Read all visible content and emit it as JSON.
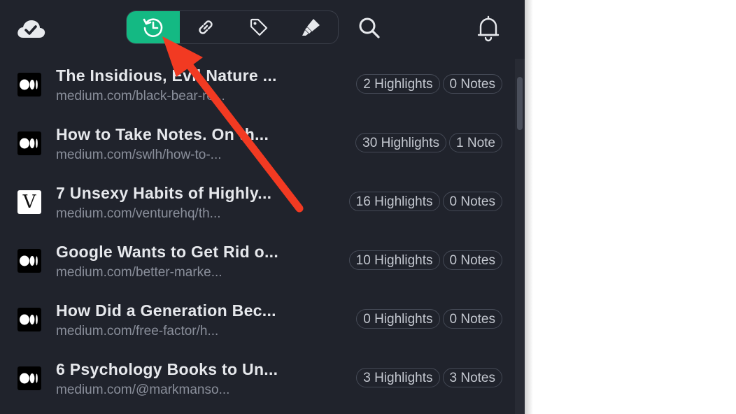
{
  "toolbar": {
    "icons": {
      "cloud": "cloud-check-icon",
      "recent": "history-icon",
      "link": "link-icon",
      "tag": "tag-icon",
      "highlighter": "highlighter-icon",
      "search": "search-icon",
      "notifications": "bell-icon"
    },
    "active_tab": "recent",
    "accent_color": "#14b983"
  },
  "articles": [
    {
      "title": "The Insidious, Evil Nature ...",
      "url": "medium.com/black-bear-re...",
      "favicon": "medium",
      "highlights": "2 Highlights",
      "notes": "0 Notes"
    },
    {
      "title": "How to Take Notes. On th...",
      "url": "medium.com/swlh/how-to-...",
      "favicon": "medium",
      "highlights": "30 Highlights",
      "notes": "1 Note"
    },
    {
      "title": "7 Unsexy Habits of Highly...",
      "url": "medium.com/venturehq/th...",
      "favicon": "letter",
      "favicon_letter": "V",
      "highlights": "16 Highlights",
      "notes": "0 Notes"
    },
    {
      "title": "Google Wants to Get Rid o...",
      "url": "medium.com/better-marke...",
      "favicon": "medium",
      "highlights": "10 Highlights",
      "notes": "0 Notes"
    },
    {
      "title": "How Did a Generation Bec...",
      "url": "medium.com/free-factor/h...",
      "favicon": "medium",
      "highlights": "0 Highlights",
      "notes": "0 Notes"
    },
    {
      "title": "6 Psychology Books to Un...",
      "url": "medium.com/@markmanso...",
      "favicon": "medium",
      "highlights": "3 Highlights",
      "notes": "3 Notes"
    }
  ],
  "annotation": {
    "arrow_color": "#f23a22"
  }
}
